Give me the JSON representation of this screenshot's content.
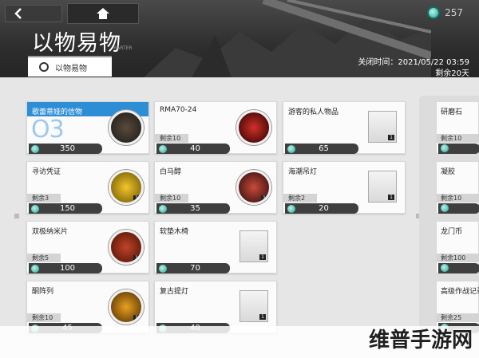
{
  "header": {
    "currency_value": "257",
    "title": "以物易物",
    "title_sub": "BARTER",
    "close_time_label": "关闭时间：2021/05/22 03:59",
    "remaining_label": "剩余20天",
    "tab_label": "以物易物"
  },
  "cards": [
    {
      "name": "歌蕾蒂娅的信物",
      "stock": "",
      "price": "350",
      "featured_num": "O3",
      "qty": ""
    },
    {
      "name": "RMA70-24",
      "stock": "剩余10",
      "price": "40",
      "qty": ""
    },
    {
      "name": "游客的私人物品",
      "stock": "",
      "price": "65",
      "qty": "1"
    },
    {
      "name": "寻访凭证",
      "stock": "剩余3",
      "price": "150",
      "qty": "1"
    },
    {
      "name": "白马醇",
      "stock": "剩余10",
      "price": "35",
      "qty": "1"
    },
    {
      "name": "海潮吊灯",
      "stock": "剩余2",
      "price": "20",
      "qty": "1"
    },
    {
      "name": "双极纳米片",
      "stock": "剩余5",
      "price": "100",
      "qty": "1"
    },
    {
      "name": "软垫木椅",
      "stock": "",
      "price": "70",
      "qty": "1"
    },
    {
      "name": "酮阵列",
      "stock": "剩余10",
      "price": "45",
      "qty": "1"
    },
    {
      "name": "复古提灯",
      "stock": "",
      "price": "40",
      "qty": "1"
    }
  ],
  "right_cards": [
    {
      "name": "研磨石",
      "stock": "剩余10"
    },
    {
      "name": "凝胶",
      "stock": "剩余10"
    },
    {
      "name": "龙门币",
      "stock": "剩余100"
    },
    {
      "name": "高级作战记录",
      "stock": "剩余25"
    }
  ],
  "watermark": "维普手游网",
  "icons": {
    "back": "back-arrow-icon",
    "home": "home-icon",
    "currency": "coin-icon",
    "tab": "tab-dot-icon"
  },
  "colors": {
    "featured": "#2d8ed6",
    "currency": "#22a593"
  }
}
